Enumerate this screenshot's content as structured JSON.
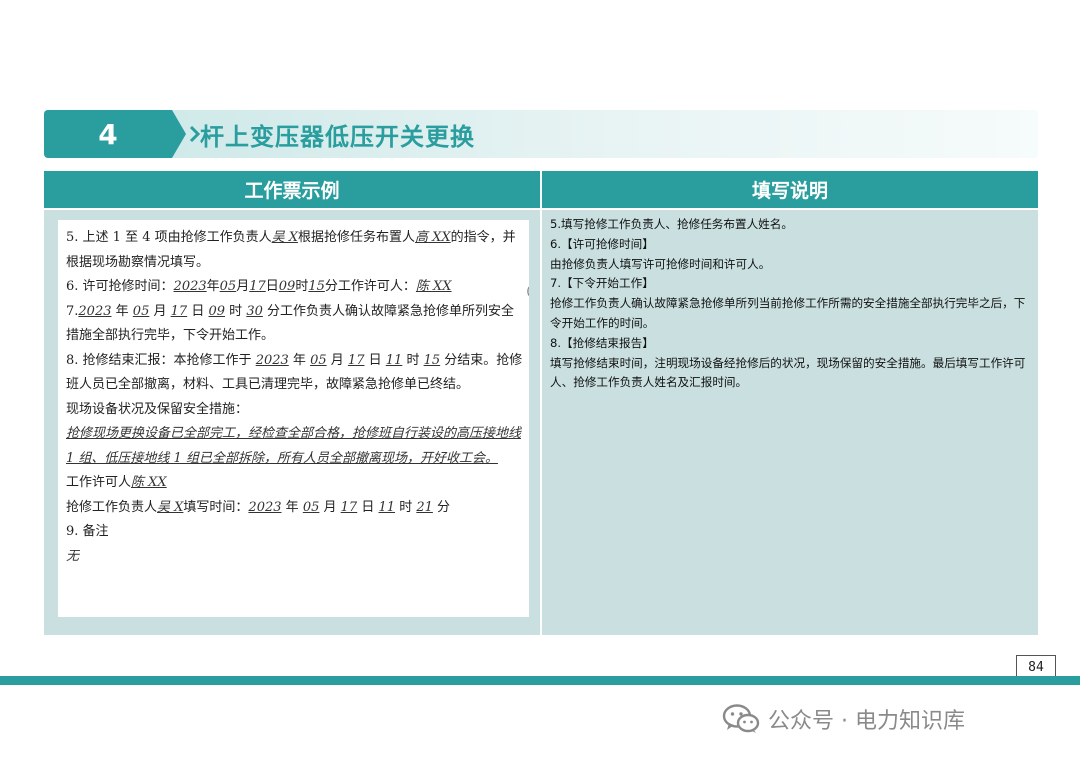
{
  "header": {
    "section_number": "4",
    "title": "杆上变压器低压开关更换"
  },
  "table": {
    "col_left": "工作票示例",
    "col_right": "填写说明"
  },
  "ticket": {
    "l5_a": "5. 上述 1 至 4 项由抢修工作负责人",
    "l5_f1": "吴 X",
    "l5_b": "根据抢修任务布置人",
    "l5_f2": "高 XX",
    "l5_c": "的指令，并根据现场勘察情况填写。",
    "l6_a": "6. 许可抢修时间：",
    "l6_year": "2023",
    "l6_year_u": "年",
    "l6_month": "05",
    "l6_month_u": "月",
    "l6_day": "17",
    "l6_day_u": "日",
    "l6_hour": "09",
    "l6_hour_u": "时",
    "l6_min": "15",
    "l6_min_u": "分工作许可人：",
    "l6_person": "陈 XX",
    "l6_stray": "(",
    "l7_a": "7.",
    "l7_year": "2023",
    "l7_year_u": "年",
    "l7_month": "05",
    "l7_month_u": "月",
    "l7_day": "17",
    "l7_day_u": "日",
    "l7_hour": "09",
    "l7_hour_u": "时",
    "l7_min": "30",
    "l7_rest": "分工作负责人确认故障紧急抢修单所列安全措施全部执行完毕，下令开始工作。",
    "l8_a": "8. 抢修结束汇报：本抢修工作于",
    "l8_year": "2023",
    "l8_year_u": "年",
    "l8_month": "05",
    "l8_month_u": "月",
    "l8_day": "17",
    "l8_day_u": "日",
    "l8_hour": "11",
    "l8_hour_u": "时",
    "l8_min": "15",
    "l8_rest": "分结束。抢修班人员已全部撤离，材料、工具已清理完毕，故障紧急抢修单已终结。",
    "site_label": "现场设备状况及保留安全措施：",
    "site_text": "抢修现场更换设备已全部完工，经检查全部合格，抢修班自行装设的高压接地线 1 组、低压接地线 1 组已全部拆除，所有人员全部撤离现场，开好收工会。",
    "permit_label": "工作许可人",
    "permit_person": "陈 XX",
    "leader_label": "抢修工作负责人",
    "leader_person": "吴 X",
    "fill_time_label": "填写时间：",
    "ft_year": "2023",
    "ft_year_u": "年",
    "ft_month": "05",
    "ft_month_u": "月",
    "ft_day": "17",
    "ft_day_u": "日",
    "ft_hour": "11",
    "ft_hour_u": "时",
    "ft_min": "21",
    "ft_min_u": "分",
    "l9_label": "9. 备注",
    "l9_value": "无"
  },
  "explain": {
    "p5": "5.填写抢修工作负责人、抢修任务布置人姓名。",
    "h6": "6.【许可抢修时间】",
    "p6": "由抢修负责人填写许可抢修时间和许可人。",
    "h7": "7.【下令开始工作】",
    "p7": "抢修工作负责人确认故障紧急抢修单所列当前抢修工作所需的安全措施全部执行完毕之后，下令开始工作的时间。",
    "h8": "8.【抢修结束报告】",
    "p8": "填写抢修结束时间，注明现场设备经抢修后的状况，现场保留的安全措施。最后填写工作许可人、抢修工作负责人姓名及汇报时间。"
  },
  "footer": {
    "page_number": "84",
    "watermark": "公众号 · 电力知识库"
  },
  "colors": {
    "accent": "#2a9d9e",
    "cell_bg": "#c9dfe0"
  }
}
